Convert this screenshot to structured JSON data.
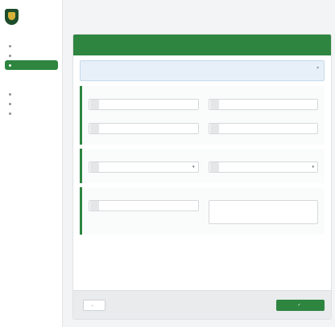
{
  "brand": {
    "name_line1": "",
    "name_line2": ""
  },
  "sidebar": {
    "items": [
      {
        "label": ""
      },
      {
        "label": ""
      },
      {
        "label": ""
      },
      {
        "label": "",
        "active": true
      },
      {
        "label": ""
      },
      {
        "label": ""
      },
      {
        "label": ""
      },
      {
        "label": ""
      },
      {
        "label": ""
      }
    ]
  },
  "header": {
    "title": "",
    "subtitle": "",
    "user": ""
  },
  "form": {
    "title": "",
    "subtitle": "",
    "info": {
      "title": "",
      "lines": [
        "",
        ""
      ]
    },
    "section1": {
      "title": "",
      "fields": [
        {
          "label": "",
          "placeholder": "",
          "help": ""
        },
        {
          "label": "",
          "placeholder": "",
          "help": ""
        },
        {
          "label": "",
          "placeholder": "",
          "help": ""
        },
        {
          "label": "",
          "placeholder": "",
          "help": ""
        }
      ]
    },
    "section2": {
      "title": "",
      "fields": [
        {
          "label": "",
          "value": "",
          "help": ""
        },
        {
          "label": "",
          "value": "",
          "help": ""
        }
      ]
    },
    "section3": {
      "title": "",
      "field": {
        "label": "",
        "placeholder": "",
        "help": ""
      },
      "textarea": {
        "label": "",
        "placeholder": "",
        "help": ""
      }
    },
    "note": ""
  },
  "footer": {
    "back_label": "",
    "submit_label": ""
  },
  "colors": {
    "accent": "#2e8540",
    "info_bg": "#e7f0f8"
  }
}
